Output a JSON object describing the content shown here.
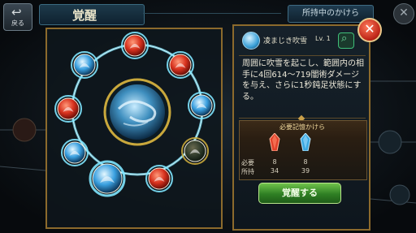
{
  "header": {
    "back_label": "戻る",
    "title": "覚醒",
    "owned_label": "所持中のかけら"
  },
  "skill": {
    "name": "凌まじき吹雪",
    "level": "Lv. 1",
    "description": "周囲に吹雪を起こし、範囲内の相手に4回614〜719闇術ダメージを与え、さらに1秒鈍足状態にする。"
  },
  "requirements": {
    "title": "必要記憶かけら",
    "rows": [
      {
        "label": "必要",
        "values": [
          "8",
          "8"
        ]
      },
      {
        "label": "所持",
        "values": [
          "34",
          "39"
        ]
      }
    ],
    "crystals": [
      {
        "icon": "red-crystal-icon",
        "color": "#e0412a"
      },
      {
        "icon": "blue-crystal-icon",
        "color": "#3aa7e0"
      }
    ]
  },
  "awaken_button": "覚醒する",
  "colors": {
    "gold_border": "#8c6a2c",
    "glow": "#7fe6ff",
    "fire": "#d8321e",
    "ice": "#3aa0e0",
    "locked": "#c9a83c"
  },
  "nodes": [
    {
      "kind": "fire",
      "state": "active"
    },
    {
      "kind": "fire",
      "state": "active"
    },
    {
      "kind": "ice",
      "state": "active"
    },
    {
      "kind": "ice",
      "state": "active"
    },
    {
      "kind": "locked",
      "state": "inactive"
    },
    {
      "kind": "fire",
      "state": "inactive"
    },
    {
      "kind": "ice",
      "state": "selected"
    },
    {
      "kind": "ice",
      "state": "active"
    },
    {
      "kind": "fire",
      "state": "active"
    },
    {
      "kind": "ice",
      "state": "active"
    }
  ]
}
